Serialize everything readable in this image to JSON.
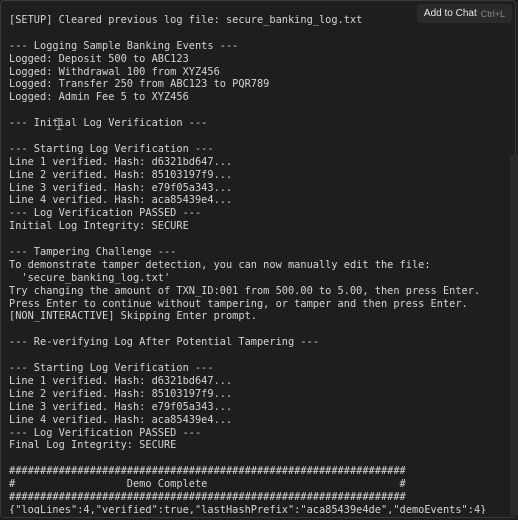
{
  "overlay": {
    "add_to_chat_label": "Add to Chat",
    "shortcut": "Ctrl+L"
  },
  "terminal": {
    "lines": [
      "[SETUP] Cleared previous log file: secure_banking_log.txt",
      "",
      "--- Logging Sample Banking Events ---",
      "Logged: Deposit 500 to ABC123",
      "Logged: Withdrawal 100 from XYZ456",
      "Logged: Transfer 250 from ABC123 to PQR789",
      "Logged: Admin Fee 5 to XYZ456",
      "",
      "--- Initial Log Verification ---",
      "",
      "--- Starting Log Verification ---",
      "Line 1 verified. Hash: d6321bd647...",
      "Line 2 verified. Hash: 85103197f9...",
      "Line 3 verified. Hash: e79f05a343...",
      "Line 4 verified. Hash: aca85439e4...",
      "--- Log Verification PASSED ---",
      "Initial Log Integrity: SECURE",
      "",
      "--- Tampering Challenge ---",
      "To demonstrate tamper detection, you can now manually edit the file:",
      "  'secure_banking_log.txt'",
      "Try changing the amount of TXN_ID:001 from 500.00 to 5.00, then press Enter.",
      "Press Enter to continue without tampering, or tamper and then press Enter.",
      "[NON_INTERACTIVE] Skipping Enter prompt.",
      "",
      "--- Re-verifying Log After Potential Tampering ---",
      "",
      "--- Starting Log Verification ---",
      "Line 1 verified. Hash: d6321bd647...",
      "Line 2 verified. Hash: 85103197f9...",
      "Line 3 verified. Hash: e79f05a343...",
      "Line 4 verified. Hash: aca85439e4...",
      "--- Log Verification PASSED ---",
      "Final Log Integrity: SECURE",
      "",
      "################################################################",
      "#                  Demo Complete                               #",
      "################################################################",
      "{\"logLines\":4,\"verified\":true,\"lastHashPrefix\":\"aca85439e4de\",\"demoEvents\":4}"
    ]
  }
}
